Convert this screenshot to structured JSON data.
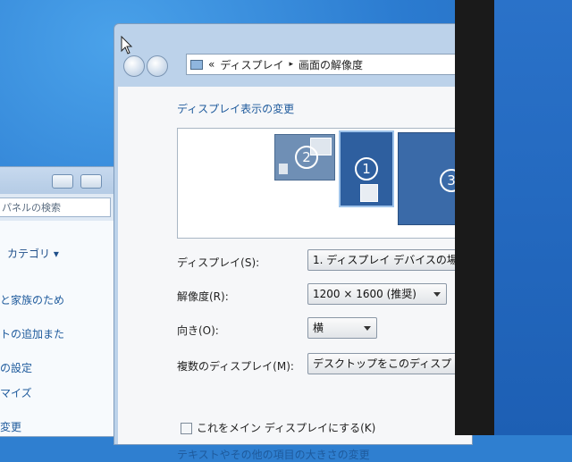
{
  "address_bar": {
    "chevrons": "«",
    "crumb1": "ディスプレイ",
    "sep": "▸",
    "crumb2": "画面の解像度"
  },
  "section_title": "ディスプレイ表示の変更",
  "monitors": [
    {
      "number": "2"
    },
    {
      "number": "1"
    },
    {
      "number": "3"
    }
  ],
  "settings": {
    "display_label": "ディスプレイ(S):",
    "display_value": "1. ディスプレイ デバイスの場",
    "resolution_label": "解像度(R):",
    "resolution_value": "1200 × 1600 (推奨)",
    "orientation_label": "向き(O):",
    "orientation_value": "横",
    "multi_label": "複数のディスプレイ(M):",
    "multi_value": "デスクトップをこのディスプ"
  },
  "main_display_checkbox": "これをメイン ディスプレイにする(K)",
  "bottom_link": "テキストやその他の項目の大きさの変更",
  "control_panel": {
    "search_placeholder": "パネルの検索",
    "category": "カテゴリ ▾",
    "links": [
      "と家族のため",
      "トの追加また",
      "の設定",
      "マイズ",
      "変更"
    ]
  },
  "colors": {
    "accent_link": "#1e5a9c",
    "desktop": "#2b7bd0",
    "monitor_selected": "#2e5f9f"
  }
}
